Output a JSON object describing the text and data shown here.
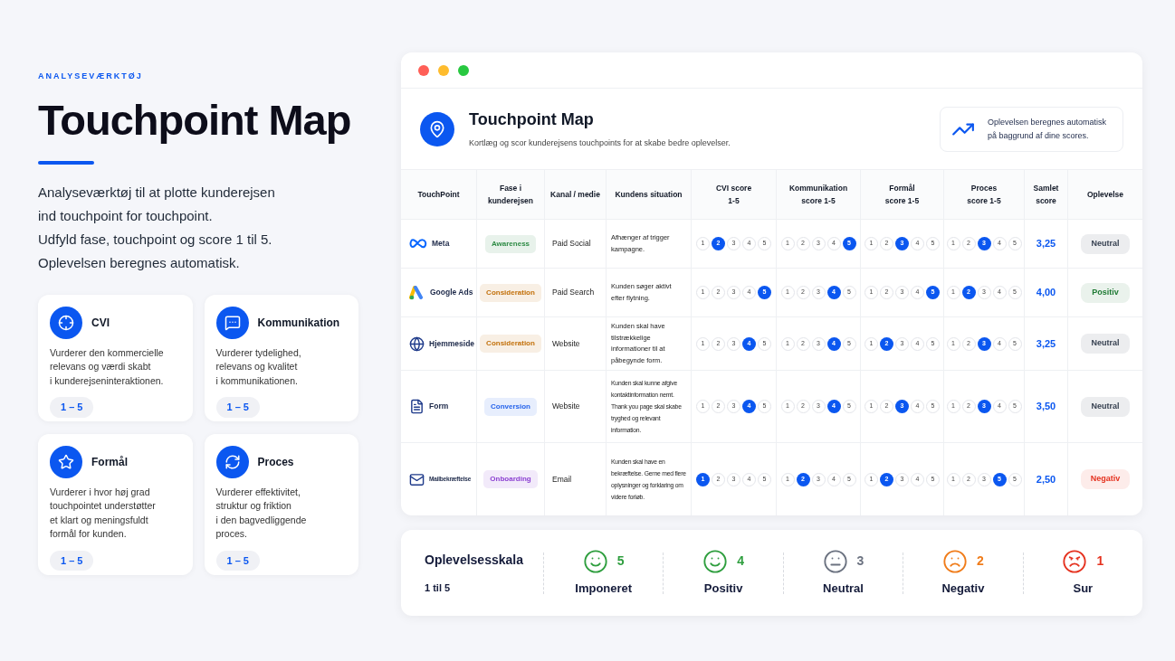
{
  "intro": {
    "eyebrow": "ANALYSEVÆRKTØJ",
    "title": "Touchpoint Map",
    "lines": [
      "Analyseværktøj til at plotte kunderejsen",
      "ind touchpoint for touchpoint.",
      "Udfyld fase, touchpoint og score 1 til 5.",
      "Oplevelsen beregnes automatisk."
    ]
  },
  "cards": [
    {
      "kind": "target",
      "title": "CVI",
      "lines": [
        "Vurderer den kommercielle",
        "relevans og værdi skabt",
        "i kunderejseninteraktionen."
      ],
      "range": "1 – 5"
    },
    {
      "kind": "chat",
      "title": "Kommunikation",
      "lines": [
        "Vurderer tydelighed,",
        "relevans og kvalitet",
        "i kommunikationen."
      ],
      "range": "1 – 5"
    },
    {
      "kind": "star",
      "title": "Formål",
      "lines": [
        "Vurderer i hvor høj grad",
        "touchpointet understøtter",
        "et klart og meningsfuldt",
        "formål for kunden."
      ],
      "range": "1 – 5"
    },
    {
      "kind": "refresh",
      "title": "Proces",
      "lines": [
        "Vurderer effektivitet,",
        "struktur og friktion",
        "i den bagvedliggende",
        "proces."
      ],
      "range": "1 – 5"
    }
  ],
  "window": {
    "title": "Touchpoint Map",
    "subtitle": "Kortlæg og scor kunderejsens touchpoints for at skabe bedre oplevelser.",
    "note": [
      "Oplevelsen beregnes automatisk",
      "på baggrund af dine scores."
    ]
  },
  "table": {
    "columns": [
      [
        "TouchPoint"
      ],
      [
        "Fase i",
        "kunderejsen"
      ],
      [
        "Kanal / medie"
      ],
      [
        "Kundens situation"
      ],
      [
        "CVI score",
        "1-5"
      ],
      [
        "Kommunikation",
        "score 1-5"
      ],
      [
        "Formål",
        "score 1-5"
      ],
      [
        "Proces",
        "score 1-5"
      ],
      [
        "Samlet",
        "score"
      ],
      [
        "Oplevelse"
      ]
    ],
    "rows": [
      {
        "kind": "meta",
        "touchpoint": "Meta",
        "phase": {
          "label": "Awareness",
          "color": "#2e8b45"
        },
        "channel": "Paid Social",
        "situation": "Afhænger af trigger kampagne.",
        "scores": [
          [
            {
              "n": "1",
              "selected": false
            },
            {
              "n": "2",
              "selected": true
            },
            {
              "n": "3",
              "selected": false
            },
            {
              "n": "4",
              "selected": false
            },
            {
              "n": "5",
              "selected": false
            }
          ],
          [
            {
              "n": "1",
              "selected": false
            },
            {
              "n": "2",
              "selected": false
            },
            {
              "n": "3",
              "selected": false
            },
            {
              "n": "4",
              "selected": false
            },
            {
              "n": "5",
              "selected": true
            }
          ],
          [
            {
              "n": "1",
              "selected": false
            },
            {
              "n": "2",
              "selected": false
            },
            {
              "n": "3",
              "selected": true
            },
            {
              "n": "4",
              "selected": false
            },
            {
              "n": "5",
              "selected": false
            }
          ],
          [
            {
              "n": "1",
              "selected": false
            },
            {
              "n": "2",
              "selected": false
            },
            {
              "n": "3",
              "selected": true
            },
            {
              "n": "4",
              "selected": false
            },
            {
              "n": "5",
              "selected": false
            }
          ]
        ],
        "total": "3,25",
        "experience": {
          "label": "Neutral",
          "color": "#374151"
        }
      },
      {
        "kind": "ads",
        "touchpoint": "Google Ads",
        "phase": {
          "label": "Consideration",
          "color": "#c2700a"
        },
        "channel": "Paid Search",
        "situation": "Kunden søger aktivt efter flytning.",
        "scores": [
          [
            {
              "n": "1",
              "selected": false
            },
            {
              "n": "2",
              "selected": false
            },
            {
              "n": "3",
              "selected": false
            },
            {
              "n": "4",
              "selected": false
            },
            {
              "n": "5",
              "selected": true
            }
          ],
          [
            {
              "n": "1",
              "selected": false
            },
            {
              "n": "2",
              "selected": false
            },
            {
              "n": "3",
              "selected": false
            },
            {
              "n": "4",
              "selected": true
            },
            {
              "n": "5",
              "selected": false
            }
          ],
          [
            {
              "n": "1",
              "selected": false
            },
            {
              "n": "2",
              "selected": false
            },
            {
              "n": "3",
              "selected": false
            },
            {
              "n": "4",
              "selected": false
            },
            {
              "n": "5",
              "selected": true
            }
          ],
          [
            {
              "n": "1",
              "selected": false
            },
            {
              "n": "2",
              "selected": true
            },
            {
              "n": "3",
              "selected": false
            },
            {
              "n": "4",
              "selected": false
            },
            {
              "n": "5",
              "selected": false
            }
          ]
        ],
        "total": "4,00",
        "experience": {
          "label": "Positiv",
          "color": "#1f7a34"
        }
      },
      {
        "kind": "globe",
        "touchpoint": "Hjemmeside",
        "phase": {
          "label": "Consideration",
          "color": "#c2700a"
        },
        "channel": "Website",
        "situation": "Kunden skal have tilstrækkelige informationer til at påbegynde form.",
        "scores": [
          [
            {
              "n": "1",
              "selected": false
            },
            {
              "n": "2",
              "selected": false
            },
            {
              "n": "3",
              "selected": false
            },
            {
              "n": "4",
              "selected": true
            },
            {
              "n": "5",
              "selected": false
            }
          ],
          [
            {
              "n": "1",
              "selected": false
            },
            {
              "n": "2",
              "selected": false
            },
            {
              "n": "3",
              "selected": false
            },
            {
              "n": "4",
              "selected": true
            },
            {
              "n": "5",
              "selected": false
            }
          ],
          [
            {
              "n": "1",
              "selected": false
            },
            {
              "n": "2",
              "selected": true
            },
            {
              "n": "3",
              "selected": false
            },
            {
              "n": "4",
              "selected": false
            },
            {
              "n": "5",
              "selected": false
            }
          ],
          [
            {
              "n": "1",
              "selected": false
            },
            {
              "n": "2",
              "selected": false
            },
            {
              "n": "3",
              "selected": true
            },
            {
              "n": "4",
              "selected": false
            },
            {
              "n": "5",
              "selected": false
            }
          ]
        ],
        "total": "3,25",
        "experience": {
          "label": "Neutral",
          "color": "#374151"
        }
      },
      {
        "kind": "form",
        "touchpoint": "Form",
        "phase": {
          "label": "Conversion",
          "color": "#2563eb"
        },
        "channel": "Website",
        "situation": "Kunden skal kunne afgive kontaktinformation nemt. Thank you page skal skabe tryghed og relevant information.",
        "scores": [
          [
            {
              "n": "1",
              "selected": false
            },
            {
              "n": "2",
              "selected": false
            },
            {
              "n": "3",
              "selected": false
            },
            {
              "n": "4",
              "selected": true
            },
            {
              "n": "5",
              "selected": false
            }
          ],
          [
            {
              "n": "1",
              "selected": false
            },
            {
              "n": "2",
              "selected": false
            },
            {
              "n": "3",
              "selected": false
            },
            {
              "n": "4",
              "selected": true
            },
            {
              "n": "5",
              "selected": false
            }
          ],
          [
            {
              "n": "1",
              "selected": false
            },
            {
              "n": "2",
              "selected": false
            },
            {
              "n": "3",
              "selected": true
            },
            {
              "n": "4",
              "selected": false
            },
            {
              "n": "5",
              "selected": false
            }
          ],
          [
            {
              "n": "1",
              "selected": false
            },
            {
              "n": "2",
              "selected": false
            },
            {
              "n": "3",
              "selected": true
            },
            {
              "n": "4",
              "selected": false
            },
            {
              "n": "5",
              "selected": false
            }
          ]
        ],
        "total": "3,50",
        "experience": {
          "label": "Neutral",
          "color": "#374151"
        }
      },
      {
        "kind": "mail",
        "touchpoint": "Mailbekræftelse",
        "phase": {
          "label": "Onboarding",
          "color": "#8b3fd1"
        },
        "channel": "Email",
        "situation": "Kunden skal have en bekræftelse. Gerne med flere oplysninger og forklaring om videre forløb.",
        "scores": [
          [
            {
              "n": "1",
              "selected": true
            },
            {
              "n": "2",
              "selected": false
            },
            {
              "n": "3",
              "selected": false
            },
            {
              "n": "4",
              "selected": false
            },
            {
              "n": "5",
              "selected": false
            }
          ],
          [
            {
              "n": "1",
              "selected": false
            },
            {
              "n": "2",
              "selected": true
            },
            {
              "n": "3",
              "selected": false
            },
            {
              "n": "4",
              "selected": false
            },
            {
              "n": "5",
              "selected": false
            }
          ],
          [
            {
              "n": "1",
              "selected": false
            },
            {
              "n": "2",
              "selected": true
            },
            {
              "n": "3",
              "selected": false
            },
            {
              "n": "4",
              "selected": false
            },
            {
              "n": "5",
              "selected": false
            }
          ],
          [
            {
              "n": "1",
              "selected": false
            },
            {
              "n": "2",
              "selected": false
            },
            {
              "n": "3",
              "selected": false
            },
            {
              "n": "5",
              "selected": true
            },
            {
              "n": "5",
              "selected": false
            }
          ]
        ],
        "total": "2,50",
        "experience": {
          "label": "Negativ",
          "color": "#e5321f"
        }
      }
    ]
  },
  "scale": {
    "title": "Oplevelsesskala",
    "subtitle": "1 til 5",
    "items": [
      {
        "kind": "smile",
        "number": "5",
        "label": "Imponeret",
        "color": "#2e9e3e"
      },
      {
        "kind": "smile",
        "number": "4",
        "label": "Positiv",
        "color": "#2e9e3e"
      },
      {
        "kind": "meh",
        "number": "3",
        "label": "Neutral",
        "color": "#6b7280"
      },
      {
        "kind": "frown",
        "number": "2",
        "label": "Negativ",
        "color": "#f07c1a"
      },
      {
        "kind": "angry",
        "number": "1",
        "label": "Sur",
        "color": "#e5321f"
      }
    ]
  }
}
